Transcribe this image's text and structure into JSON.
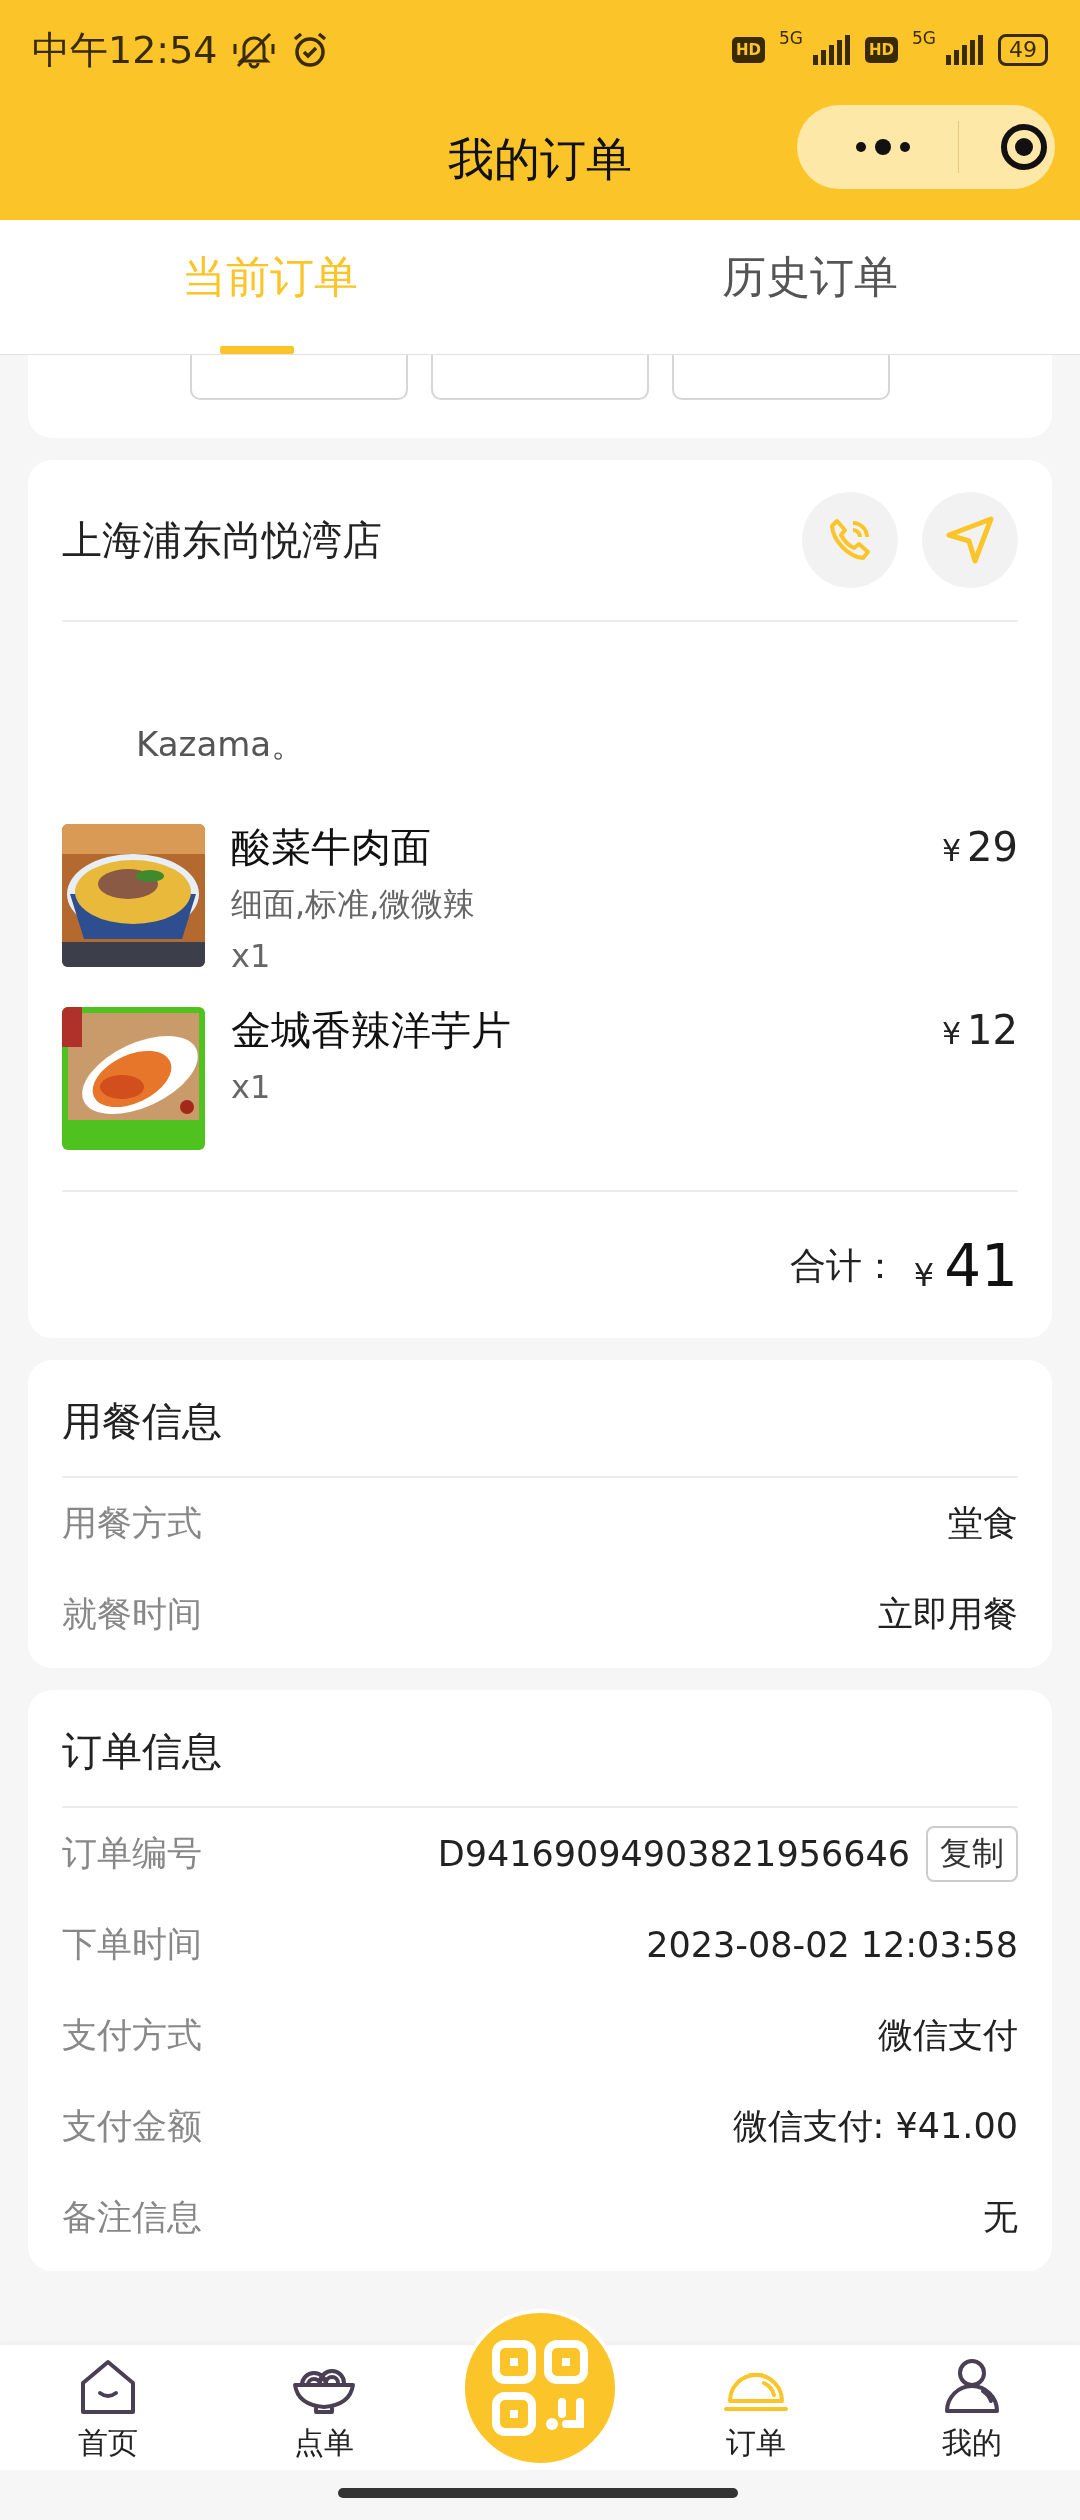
{
  "status_bar": {
    "time": "中午12:54",
    "sims": [
      {
        "hd": "HD",
        "net": "5G"
      },
      {
        "hd": "HD",
        "net": "5G"
      }
    ],
    "battery": "49"
  },
  "header": {
    "title": "我的订单"
  },
  "tabs": [
    {
      "label": "当前订单",
      "selected": true
    },
    {
      "label": "历史订单",
      "selected": false
    }
  ],
  "store": {
    "name": "上海浦东尚悦湾店",
    "note": "Kazama。",
    "items": [
      {
        "kind": "noodles",
        "name": "酸菜牛肉面",
        "spec": "细面,标准,微微辣",
        "qty": "x1",
        "currency": "¥",
        "price": "29"
      },
      {
        "kind": "chips",
        "name": "金城香辣洋芋片",
        "qty": "x1",
        "currency": "¥",
        "price": "12"
      }
    ],
    "total_label": "合计：",
    "total_currency": "¥",
    "total": "41"
  },
  "dining_info": {
    "title": "用餐信息",
    "rows": [
      {
        "label": "用餐方式",
        "value": "堂食"
      },
      {
        "label": "就餐时间",
        "value": "立即用餐"
      }
    ]
  },
  "order_info": {
    "title": "订单信息",
    "rows": [
      {
        "label": "订单编号",
        "value": "D94169094903821956646",
        "action": "复制"
      },
      {
        "label": "下单时间",
        "value": "2023-08-02 12:03:58"
      },
      {
        "label": "支付方式",
        "value": "微信支付"
      },
      {
        "label": "支付金额",
        "value": "微信支付: ¥41.00"
      },
      {
        "label": "备注信息",
        "value": "无"
      }
    ]
  },
  "nav": [
    {
      "kind": "home",
      "label": "首页",
      "selected": false
    },
    {
      "kind": "menu",
      "label": "点单",
      "selected": false
    },
    {
      "kind": "orders",
      "label": "订单",
      "selected": true
    },
    {
      "kind": "profile",
      "label": "我的",
      "selected": false
    }
  ]
}
